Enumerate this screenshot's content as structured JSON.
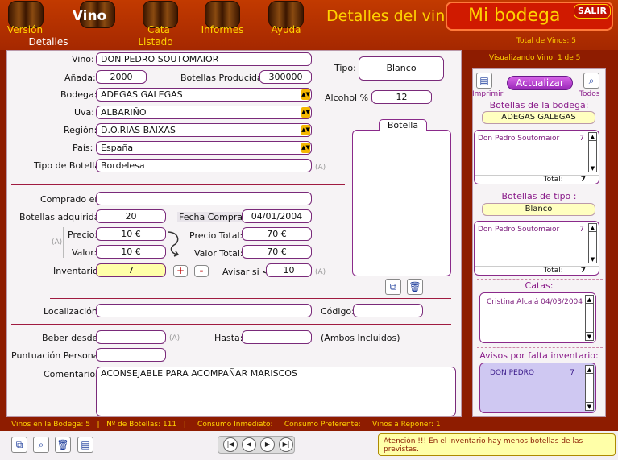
{
  "nav": {
    "version": "Versión",
    "details": "Detalles",
    "vino": "Vino",
    "cata": "Cata",
    "listado": "Listado",
    "informes": "Informes",
    "ayuda": "Ayuda"
  },
  "header": {
    "page_title": "Detalles del vino",
    "app_title": "Mi bodega",
    "salir": "SALIR",
    "total_vinos": "Total de Vinos: 5",
    "visualizando": "Visualizando Vino: 1 de 5"
  },
  "form": {
    "vino_label": "Vino:",
    "vino": "DON PEDRO SOUTOMAIOR",
    "anada_label": "Añada:",
    "anada": "2000",
    "bot_prod_label": "Botellas Producidas:",
    "bot_prod": "300000",
    "tipo_label": "Tipo:",
    "tipo": "Blanco",
    "bodega_label": "Bodega:",
    "bodega": "ADEGAS GALEGAS",
    "alcohol_label": "Alcohol % :",
    "alcohol": "12",
    "uva_label": "Uva:",
    "uva": "ALBARIÑO",
    "region_label": "Región:",
    "region": "D.O.RIAS BAIXAS",
    "pais_label": "País:",
    "pais": "España",
    "tipo_bot_label": "Tipo de Botella:",
    "tipo_bot": "Bordelesa",
    "hint_a": "(A)",
    "botella_label": "Botella",
    "comprado_label": "Comprado en:",
    "comprado": "",
    "bot_adq_label": "Botellas adquiridas:",
    "bot_adq": "20",
    "fecha_label": "Fecha Compra:",
    "fecha": "04/01/2004",
    "precio_label": "Precio:",
    "precio": "10 €",
    "precio_total_label": "Precio Total:",
    "precio_total": "70 €",
    "valor_label": "Valor:",
    "valor": "10 €",
    "valor_total_label": "Valor Total:",
    "valor_total": "70 €",
    "inventario_label": "Inventario:",
    "inventario": "7",
    "plus": "+",
    "minus": "-",
    "avisar_label": "Avisar si <",
    "avisar": "10",
    "localizacion_label": "Localización:",
    "localizacion": "",
    "codigo_label": "Código:",
    "codigo": "",
    "beber_label": "Beber desde:",
    "beber": "",
    "hasta_label": "Hasta:",
    "hasta": "",
    "ambos": "(Ambos Incluidos)",
    "puntuacion_label": "Puntuación Personal:",
    "puntuacion": "",
    "comentarios_label": "Comentarios:",
    "comentarios": "ACONSEJABLE PARA ACOMPAÑAR MARISCOS"
  },
  "side": {
    "imprimir": "Imprimir",
    "actualizar": "Actualizar",
    "todos": "Todos",
    "bodega_title": "Botellas de la bodega:",
    "bodega_value": "ADEGAS GALEGAS",
    "bodega_row_name": "Don Pedro Soutomaior",
    "bodega_row_count": "7",
    "total_label": "Total:",
    "bodega_total": "7",
    "tipo_title": "Botellas de tipo :",
    "tipo_value": "Blanco",
    "tipo_row_name": "Don Pedro Soutomaior",
    "tipo_row_count": "7",
    "tipo_total": "7",
    "catas_title": "Catas:",
    "cata_name": "Cristina Alcalá",
    "cata_date": "04/03/2004",
    "avisos_title": "Avisos por falta inventario:",
    "aviso_name": "DON PEDRO",
    "aviso_count": "7"
  },
  "status": {
    "text": "Vinos en la Bodega: 5   |   Nº de Botellas: 111   |     Consumo Inmediato:     Consumo Preferente:     Vinos a Reponer: 1"
  },
  "alert": {
    "text": "Atención !!!    En el inventario hay menos botellas de las previstas."
  },
  "colors": {
    "brand": "#a52800",
    "accent": "#ffd200",
    "purple": "#8a1c8a"
  }
}
